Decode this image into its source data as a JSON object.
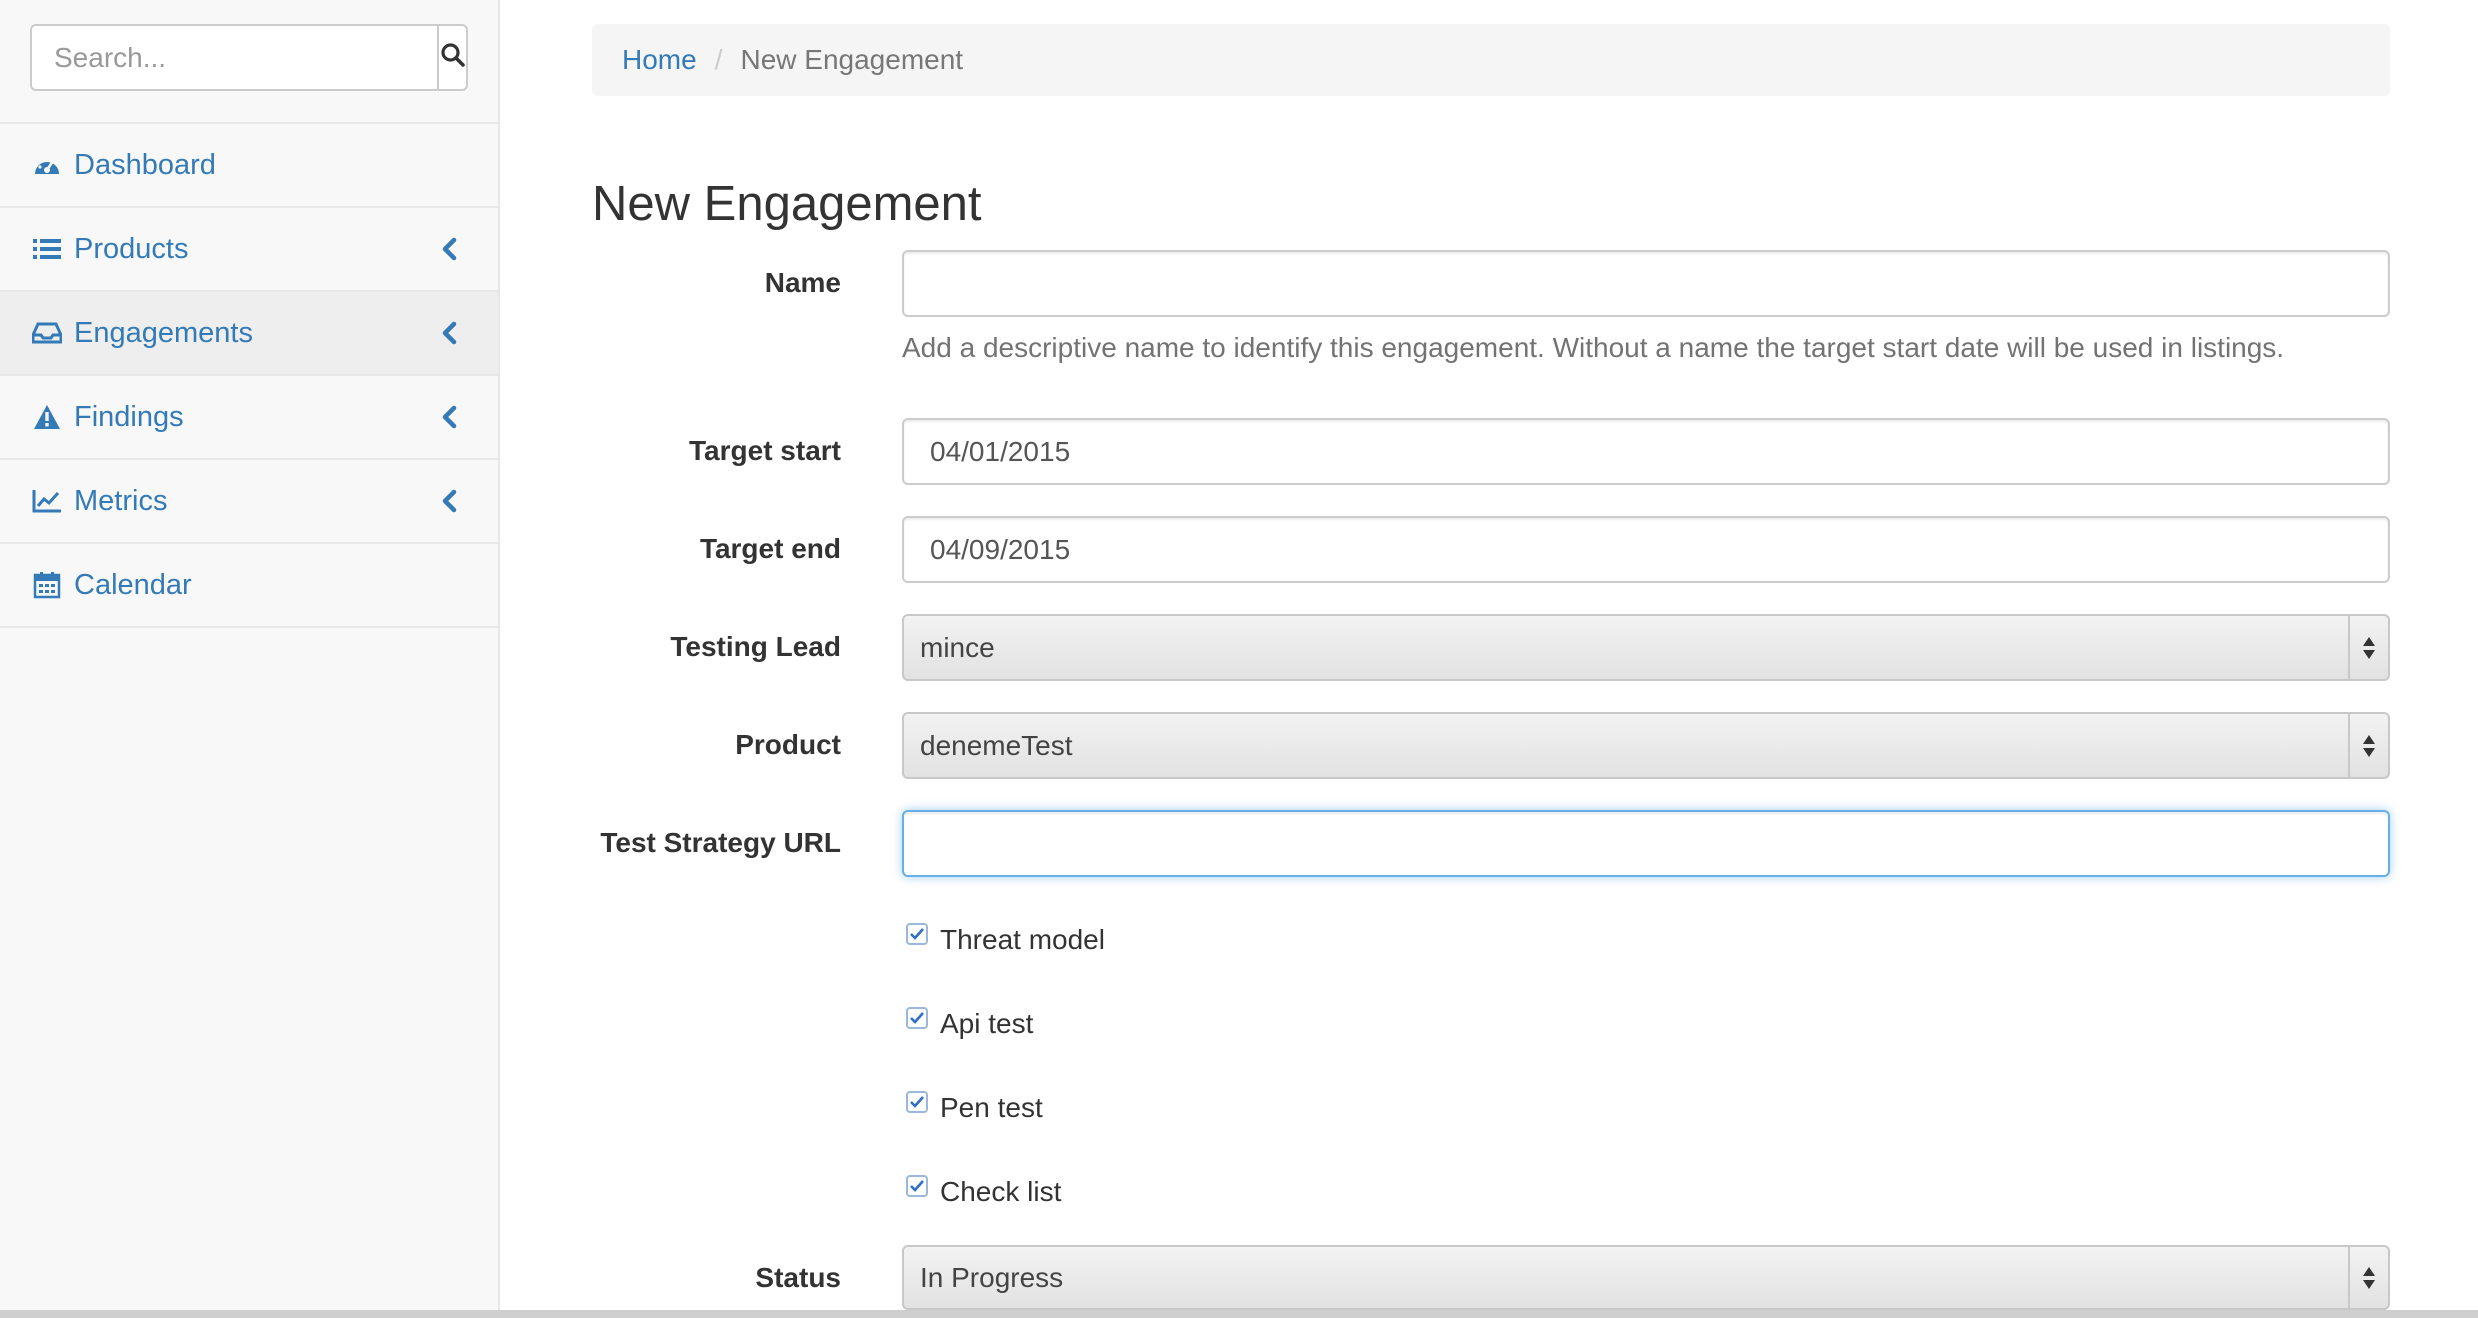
{
  "search": {
    "placeholder": "Search..."
  },
  "sidebar": {
    "items": [
      {
        "label": "Dashboard",
        "icon": "dashboard-icon",
        "has_arrow": false,
        "active": false
      },
      {
        "label": "Products",
        "icon": "list-icon",
        "has_arrow": true,
        "active": false
      },
      {
        "label": "Engagements",
        "icon": "inbox-icon",
        "has_arrow": true,
        "active": true
      },
      {
        "label": "Findings",
        "icon": "warning-icon",
        "has_arrow": true,
        "active": false
      },
      {
        "label": "Metrics",
        "icon": "line-chart-icon",
        "has_arrow": true,
        "active": false
      },
      {
        "label": "Calendar",
        "icon": "calendar-icon",
        "has_arrow": false,
        "active": false
      }
    ]
  },
  "breadcrumb": {
    "home": "Home",
    "separator": "/",
    "current": "New Engagement"
  },
  "page": {
    "title": "New Engagement"
  },
  "form": {
    "name": {
      "label": "Name",
      "value": "",
      "help": "Add a descriptive name to identify this engagement. Without a name the target start date will be used in listings."
    },
    "target_start": {
      "label": "Target start",
      "value": "04/01/2015"
    },
    "target_end": {
      "label": "Target end",
      "value": "04/09/2015"
    },
    "testing_lead": {
      "label": "Testing Lead",
      "value": "mince"
    },
    "product": {
      "label": "Product",
      "value": "denemeTest"
    },
    "test_strategy": {
      "label": "Test Strategy URL",
      "value": ""
    },
    "checkboxes": [
      {
        "label": "Threat model",
        "checked": true
      },
      {
        "label": "Api test",
        "checked": true
      },
      {
        "label": "Pen test",
        "checked": true
      },
      {
        "label": "Check list",
        "checked": true
      }
    ],
    "status": {
      "label": "Status",
      "value": "In Progress"
    }
  },
  "colors": {
    "link": "#337ab7",
    "focus": "#66afe9",
    "check": "#2f6fc9"
  }
}
